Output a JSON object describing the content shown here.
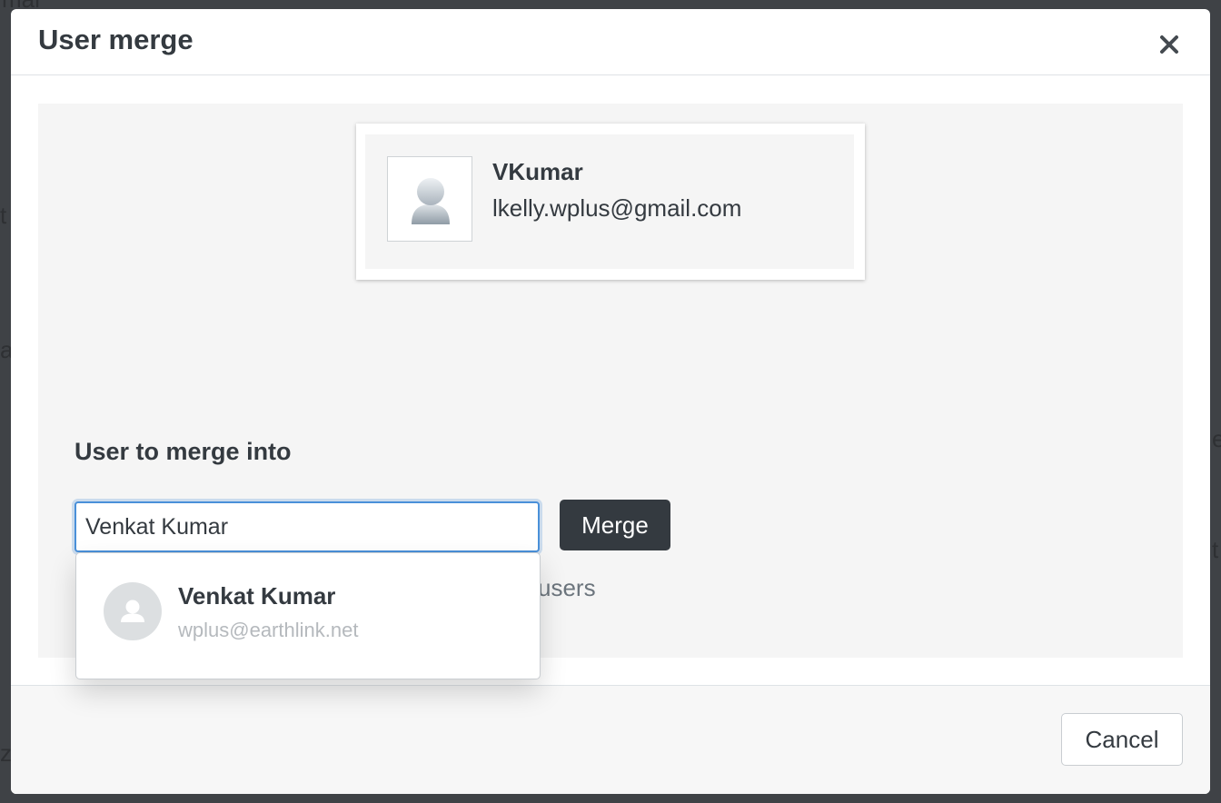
{
  "background_page": {
    "fragments": [
      "mar",
      "t",
      "a",
      "e",
      "t",
      "z"
    ]
  },
  "modal": {
    "title": "User merge",
    "close_icon": "close-icon"
  },
  "source_user": {
    "avatar_icon": "default-user-avatar-icon",
    "name": "VKumar",
    "email": "lkelly.wplus@gmail.com"
  },
  "merge_target": {
    "label": "User to merge into",
    "input_value": "Venkat Kumar",
    "merge_button": "Merge",
    "hint_visible_tail": "users"
  },
  "autocomplete": {
    "items": [
      {
        "avatar_icon": "user-avatar-icon",
        "name": "Venkat Kumar",
        "email": "wplus@earthlink.net"
      }
    ]
  },
  "footer": {
    "cancel_button": "Cancel"
  },
  "colors": {
    "overlay": "#3f4246",
    "primary_dark": "#343a40",
    "panel_bg": "#f5f5f5",
    "focus_border": "#4a90d9",
    "muted_text": "#6c757d",
    "email_muted": "#b5b9bd"
  }
}
